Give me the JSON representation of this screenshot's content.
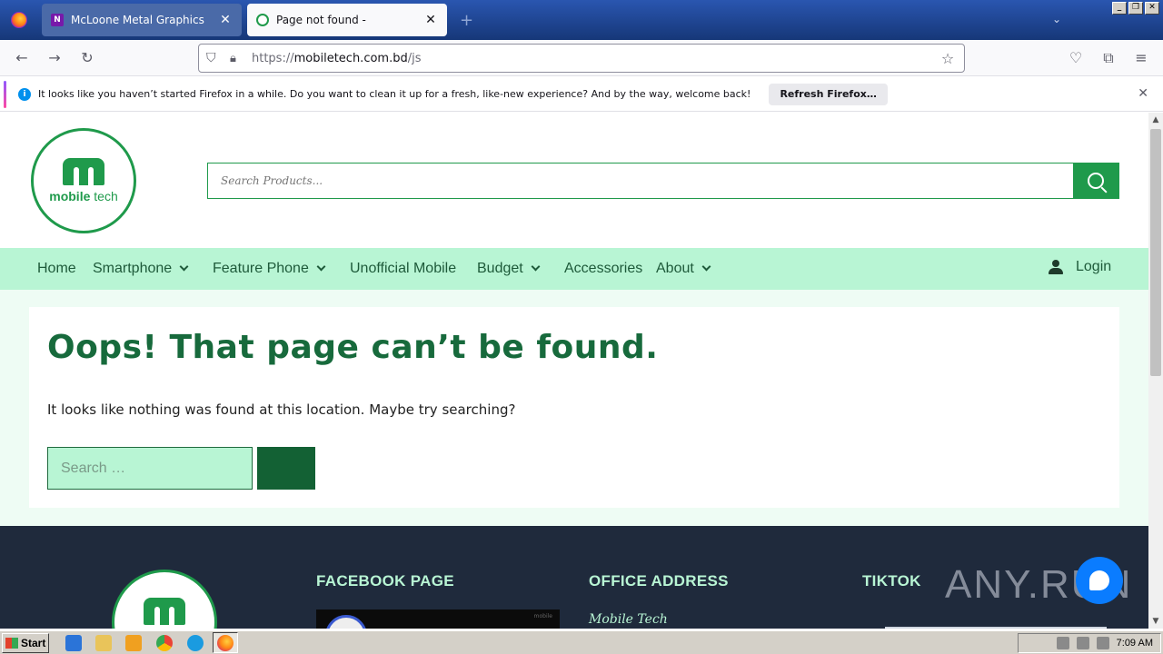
{
  "browser": {
    "tabs": [
      {
        "title": "McLoone Metal Graphics",
        "active": false
      },
      {
        "title": "Page not found -",
        "active": true
      }
    ],
    "url_scheme": "https://",
    "url_host": "mobiletech.com.bd",
    "url_path": "/js",
    "notification": {
      "message": "It looks like you haven’t started Firefox in a while. Do you want to clean it up for a fresh, like-new experience? And by the way, welcome back!",
      "button": "Refresh Firefox…"
    }
  },
  "site": {
    "logo_text_bold": "mobile",
    "logo_text_light": " tech",
    "search_placeholder": "Search Products...",
    "nav": [
      {
        "label": "Home",
        "dropdown": false
      },
      {
        "label": "Smartphone",
        "dropdown": true
      },
      {
        "label": "Feature Phone",
        "dropdown": true
      },
      {
        "label": "Unofficial Mobile",
        "dropdown": false
      },
      {
        "label": "Budget",
        "dropdown": true
      },
      {
        "label": "Accessories",
        "dropdown": false
      },
      {
        "label": "About",
        "dropdown": true
      }
    ],
    "login_label": "Login",
    "error_title": "Oops! That page can’t be found.",
    "error_message": "It looks like nothing was found at this location. Maybe try searching?",
    "search2_placeholder": "Search …",
    "footer": {
      "facebook_heading": "FACEBOOK PAGE",
      "office_heading": "OFFICE ADDRESS",
      "office_name": "Mobile Tech",
      "tiktok_heading": "TIKTOK"
    },
    "watermark": "ANY.RUN"
  },
  "taskbar": {
    "start_label": "Start",
    "clock": "7:09 AM"
  },
  "colors": {
    "brand_green": "#1f9a4b",
    "nav_mint": "#b8f5d4",
    "dark_green": "#136134",
    "footer_bg": "#1f2a3c"
  }
}
